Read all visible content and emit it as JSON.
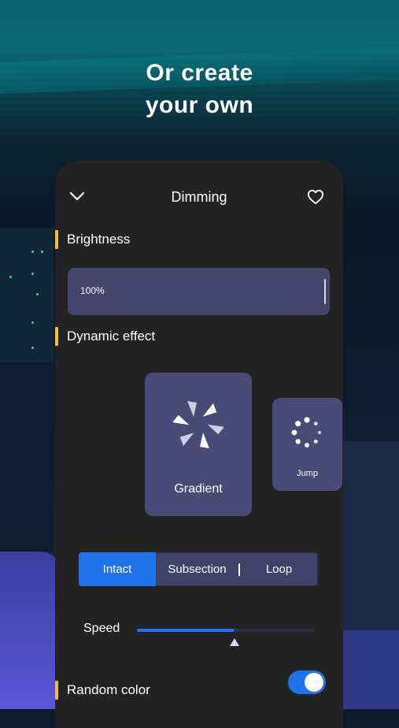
{
  "hero": {
    "title_line1": "Or create",
    "title_line2": "your own"
  },
  "topbar": {
    "title": "Dimming",
    "back_icon": "chevron-down-icon",
    "favorite_icon": "heart-icon"
  },
  "brightness": {
    "label": "Brightness",
    "value_text": "100%",
    "level": 1.0
  },
  "dynamic_effect": {
    "label": "Dynamic effect",
    "effects": [
      {
        "label": "Gradient",
        "icon": "pinwheel-icon",
        "selected": true
      },
      {
        "label": "Jump",
        "icon": "dots-spinner-icon",
        "selected": false
      }
    ]
  },
  "mode_tabs": {
    "items": [
      "Intact",
      "Subsection",
      "Loop"
    ],
    "active": "Intact"
  },
  "speed": {
    "label": "Speed",
    "level": 0.55
  },
  "random_color": {
    "label": "Random color",
    "enabled": true
  },
  "colors": {
    "accent": "#1f72ea",
    "section_marker": "#f3bf31",
    "card": "#484a78",
    "panel": "#232323"
  }
}
